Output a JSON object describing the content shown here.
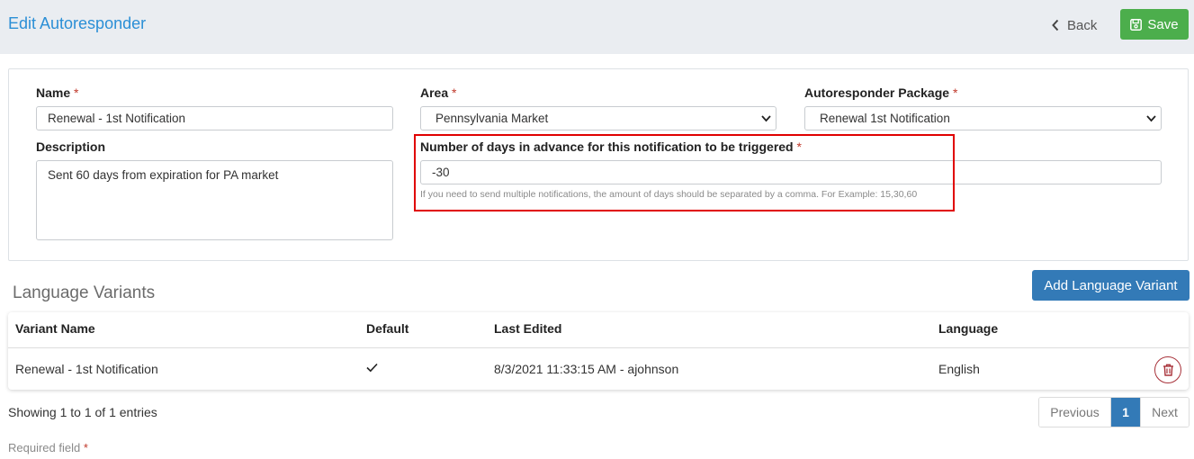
{
  "header": {
    "title": "Edit Autoresponder",
    "back_label": "Back",
    "save_label": "Save"
  },
  "form": {
    "required_mark": "*",
    "name": {
      "label": "Name",
      "value": "Renewal - 1st Notification"
    },
    "area": {
      "label": "Area",
      "value": "Pennsylvania Market"
    },
    "package": {
      "label": "Autoresponder Package",
      "value": "Renewal 1st Notification"
    },
    "description": {
      "label": "Description",
      "value": "Sent 60 days from expiration for PA market"
    },
    "days": {
      "label": "Number of days in advance for this notification to be triggered",
      "value": "-30",
      "hint": "If you need to send multiple notifications, the amount of days should be separated by a comma. For Example: 15,30,60"
    }
  },
  "variants": {
    "title": "Language Variants",
    "add_label": "Add Language Variant",
    "columns": {
      "name": "Variant Name",
      "default": "Default",
      "last_edited": "Last Edited",
      "language": "Language"
    },
    "rows": [
      {
        "name": "Renewal - 1st Notification",
        "is_default": true,
        "last_edited": "8/3/2021 11:33:15 AM - ajohnson",
        "language": "English"
      }
    ],
    "showing": "Showing 1 to 1 of 1 entries",
    "pagination": {
      "previous": "Previous",
      "current": "1",
      "next": "Next"
    }
  },
  "footer": {
    "required_text": "Required field",
    "required_mark": "*"
  },
  "colors": {
    "title_blue": "#2b8fd6",
    "save_green": "#4cae4c",
    "primary_blue": "#337ab7",
    "required_red": "#c0392b",
    "highlight_red": "#e00000",
    "delete_red": "#a8323a"
  },
  "icons": {
    "back": "chevron-left-icon",
    "save": "floppy-disk-icon",
    "select": "chevron-down-icon",
    "default": "check-icon",
    "delete": "trash-icon"
  }
}
